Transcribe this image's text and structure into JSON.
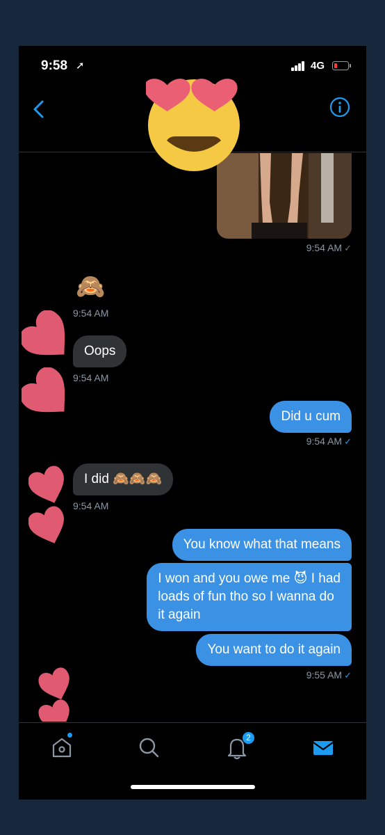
{
  "status_bar": {
    "time": "9:58",
    "location_glyph": "➚",
    "network": "4G"
  },
  "header": {
    "back_icon": "chevron-left-icon",
    "info_icon": "info-icon",
    "avatar_cover": "😍"
  },
  "colors": {
    "accent": "#1d9bf0",
    "outgoing_bubble": "#3b91e4",
    "incoming_bubble": "#2f3336",
    "heart": "#e05a72"
  },
  "messages": [
    {
      "id": "m1",
      "direction": "out",
      "type": "image",
      "timestamp": "9:54 AM",
      "status": "✓"
    },
    {
      "id": "m2",
      "direction": "in",
      "type": "emoji",
      "text": "🙈",
      "timestamp": "9:54 AM"
    },
    {
      "id": "m3",
      "direction": "in",
      "type": "text",
      "text": "Oops",
      "timestamp": "9:54 AM"
    },
    {
      "id": "m4",
      "direction": "out",
      "type": "text",
      "text": "Did u cum",
      "timestamp": "9:54 AM",
      "status": "✓"
    },
    {
      "id": "m5",
      "direction": "in",
      "type": "text",
      "text": "I did 🙈🙈🙈",
      "timestamp": "9:54 AM"
    },
    {
      "id": "m6",
      "direction": "out",
      "type": "text",
      "text": "You know what that means"
    },
    {
      "id": "m7",
      "direction": "out",
      "type": "text",
      "text_lines": [
        "I won and you owe me 😈 I had",
        "loads of fun tho so I wanna do",
        "it again"
      ]
    },
    {
      "id": "m8",
      "direction": "out",
      "type": "text",
      "text": "You want to do it again",
      "timestamp": "9:55 AM",
      "status": "✓"
    },
    {
      "id": "m9",
      "direction": "in",
      "type": "emoji",
      "text": "😍 😘"
    }
  ],
  "tab_bar": {
    "tabs": [
      {
        "name": "home",
        "icon": "home-icon"
      },
      {
        "name": "search",
        "icon": "search-icon"
      },
      {
        "name": "notifications",
        "icon": "bell-icon",
        "badge": "2"
      },
      {
        "name": "messages",
        "icon": "mail-icon",
        "active": true
      }
    ]
  }
}
